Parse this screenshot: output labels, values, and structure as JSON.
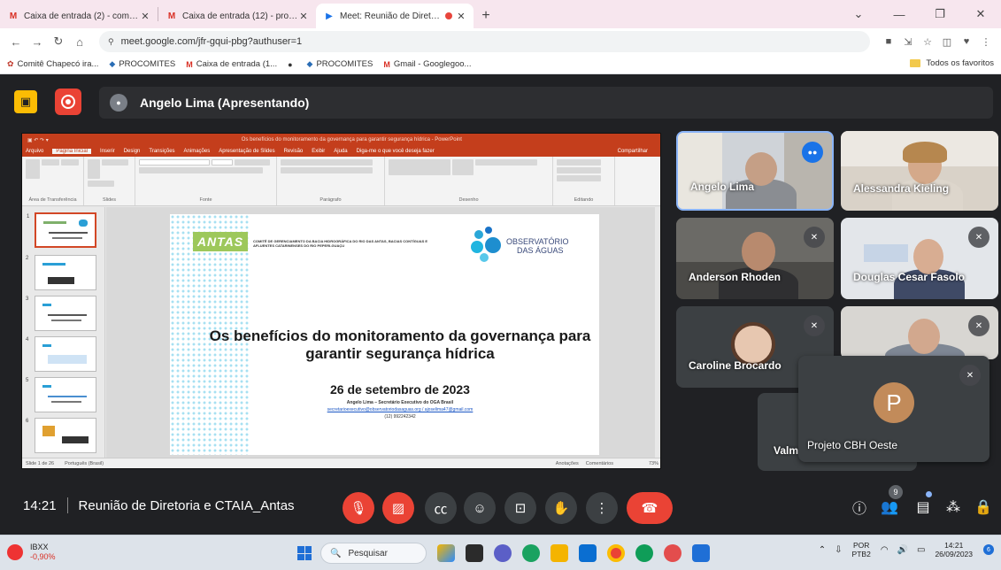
{
  "browser": {
    "tabs": [
      {
        "label": "Caixa de entrada (2) - comitecha",
        "icon": "gmail-icon",
        "active": false
      },
      {
        "label": "Caixa de entrada (12) - projetoc",
        "icon": "gmail-icon",
        "active": false
      },
      {
        "label": "Meet: Reunião de Diretoria e",
        "icon": "meet-icon",
        "active": true
      }
    ],
    "new_tab": "+",
    "url": "meet.google.com/jfr-gqui-pbg?authuser=1",
    "bookmarks": [
      {
        "label": "Comitê Chapecó ira..."
      },
      {
        "label": "PROCOMITES"
      },
      {
        "label": "Caixa de entrada (1..."
      },
      {
        "label": ""
      },
      {
        "label": "PROCOMITES"
      },
      {
        "label": "Gmail - Googlegoo..."
      }
    ],
    "favorites_label": "Todos os favoritos"
  },
  "meeting": {
    "presenter_label": "Angelo Lima (Apresentando)",
    "time": "14:21",
    "title": "Reunião de Diretoria e CTAIA_Antas",
    "participant_count": "9"
  },
  "presentation": {
    "window_title": "Os benefícios do monitoramento da governança para garantir segurança hídrica - PowerPoint",
    "ribbon_tabs": [
      "Arquivo",
      "Página Inicial",
      "Inserir",
      "Design",
      "Transições",
      "Animações",
      "Apresentação de Slides",
      "Revisão",
      "Exibir",
      "Ajuda",
      "Diga-me o que você deseja fazer"
    ],
    "share_label": "Compartilhar",
    "ribbon_groups": [
      "Área de Transferência",
      "Slides",
      "Fonte",
      "Parágrafo",
      "Desenho",
      "Editando"
    ],
    "thumb_numbers": [
      "1",
      "2",
      "3",
      "4",
      "5",
      "6"
    ],
    "slide": {
      "logo_text": "ANTAS",
      "committee": "COMITÊ DE GERENCIAMENTO DA BACIA HIDROGRÁFICA DO RIO DAS ANTAS, BACIAS CONTÍGUAS E AFLUENTES CATARINENSES DO RIO PEPERI-GUAÇU",
      "obs_line1": "OBSERVATÓRIO",
      "obs_line2": "DAS ÁGUAS",
      "title": "Os benefícios do monitoramento da governança para garantir segurança hídrica",
      "date": "26 de setembro de 2023",
      "author": "Angelo Lima – Secretário Executivo do OGA Brasil",
      "emails": "secretarioexecutivo@observatoriodasaguas.org / ajoselima47@gmail.com",
      "phone": "(12) 992242342"
    },
    "status_left": "Slide 1 de 26",
    "status_lang": "Português (Brasil)",
    "status_notes": "Anotações",
    "status_comments": "Comentários",
    "zoom": "73%"
  },
  "participants": [
    {
      "name": "Angelo Lima",
      "speaking": true
    },
    {
      "name": "Alessandra Kieling",
      "muted": false
    },
    {
      "name": "Anderson Rhoden",
      "muted": true
    },
    {
      "name": "Douglas Cesar Fasolo",
      "muted": true
    },
    {
      "name": "Caroline Brocardo",
      "muted": true
    },
    {
      "name": "Valm",
      "muted": true
    },
    {
      "name": "Projeto CBH Oeste",
      "initial": "P",
      "muted": true
    }
  ],
  "taskbar": {
    "ticker": "IBXX",
    "change": "-0,90%",
    "search_placeholder": "Pesquisar",
    "lang_top": "POR",
    "lang_bottom": "PTB2",
    "time": "14:21",
    "date": "26/09/2023",
    "notif_count": "6"
  },
  "colors": {
    "meet_bg": "#202124",
    "red": "#ea4335",
    "ppt_red": "#c43e1c",
    "present_yellow": "#fbbc04",
    "antas_green": "#9dc85b"
  }
}
